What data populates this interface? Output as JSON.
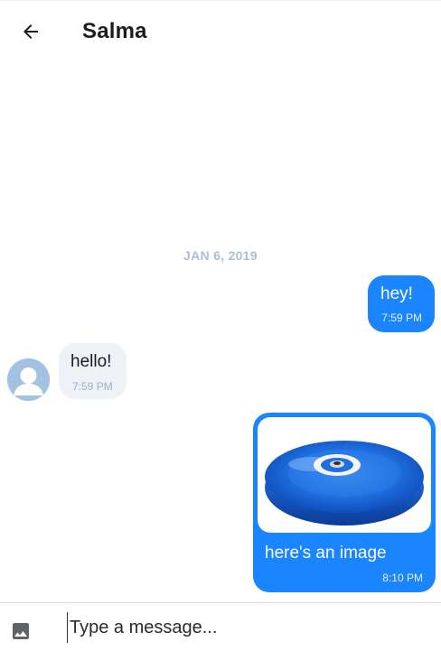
{
  "header": {
    "back_icon": "arrow-left-icon",
    "title": "Salma"
  },
  "conversation": {
    "date_separator": "JAN 6, 2019",
    "messages": [
      {
        "direction": "outgoing",
        "text": "hey!",
        "time": "7:59 PM"
      },
      {
        "direction": "incoming",
        "text": "hello!",
        "time": "7:59 PM",
        "avatar_icon": "user-avatar-icon"
      },
      {
        "direction": "outgoing",
        "text": "here's an image",
        "time": "8:10 PM",
        "attachment": "image"
      }
    ]
  },
  "composer": {
    "image_icon": "image-icon",
    "placeholder": "Type a message..."
  },
  "colors": {
    "accent": "#1a85ff",
    "incoming_bubble": "#eef1f6",
    "date_text": "#a9bfd6",
    "avatar": "#a3c1e3"
  }
}
